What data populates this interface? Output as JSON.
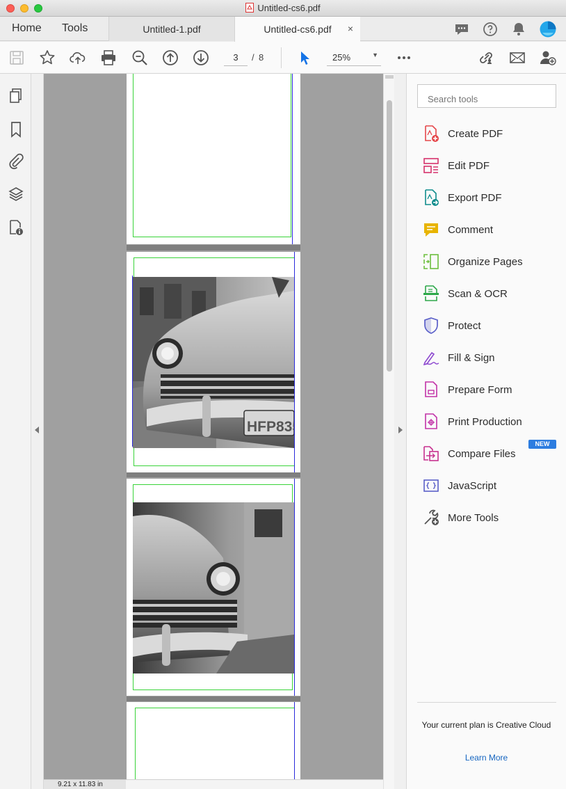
{
  "window": {
    "title": "Untitled-cs6.pdf"
  },
  "nav": {
    "home": "Home",
    "tools": "Tools"
  },
  "tabs": [
    {
      "label": "Untitled-1.pdf"
    },
    {
      "label": "Untitled-cs6.pdf",
      "close": "×"
    }
  ],
  "toolbar": {
    "current_page": "3",
    "page_separator": "/",
    "total_pages": "8",
    "zoom": "25%"
  },
  "status": {
    "dimensions": "9.21 x 11.83 in"
  },
  "tools_pane": {
    "search_placeholder": "Search tools",
    "items": [
      {
        "label": "Create PDF",
        "icon": "create-pdf-icon",
        "color": "#e5474b"
      },
      {
        "label": "Edit PDF",
        "icon": "edit-pdf-icon",
        "color": "#d6336c"
      },
      {
        "label": "Export PDF",
        "icon": "export-pdf-icon",
        "color": "#0f8c8c"
      },
      {
        "label": "Comment",
        "icon": "comment-icon",
        "color": "#e8b400"
      },
      {
        "label": "Organize Pages",
        "icon": "organize-pages-icon",
        "color": "#6cbf3c"
      },
      {
        "label": "Scan & OCR",
        "icon": "scan-ocr-icon",
        "color": "#2ea84a"
      },
      {
        "label": "Protect",
        "icon": "protect-icon",
        "color": "#5a5fc9"
      },
      {
        "label": "Fill & Sign",
        "icon": "fill-sign-icon",
        "color": "#8e4ad0"
      },
      {
        "label": "Prepare Form",
        "icon": "prepare-form-icon",
        "color": "#c232a8"
      },
      {
        "label": "Print Production",
        "icon": "print-production-icon",
        "color": "#c232a8"
      },
      {
        "label": "Compare Files",
        "icon": "compare-files-icon",
        "color": "#c7318f"
      },
      {
        "label": "JavaScript",
        "icon": "javascript-icon",
        "color": "#5a5fc9"
      },
      {
        "label": "More Tools",
        "icon": "more-tools-icon",
        "color": "#555555"
      }
    ],
    "new_badge": "NEW",
    "plan_text": "Your current plan is Creative Cloud",
    "learn_more": "Learn More"
  }
}
